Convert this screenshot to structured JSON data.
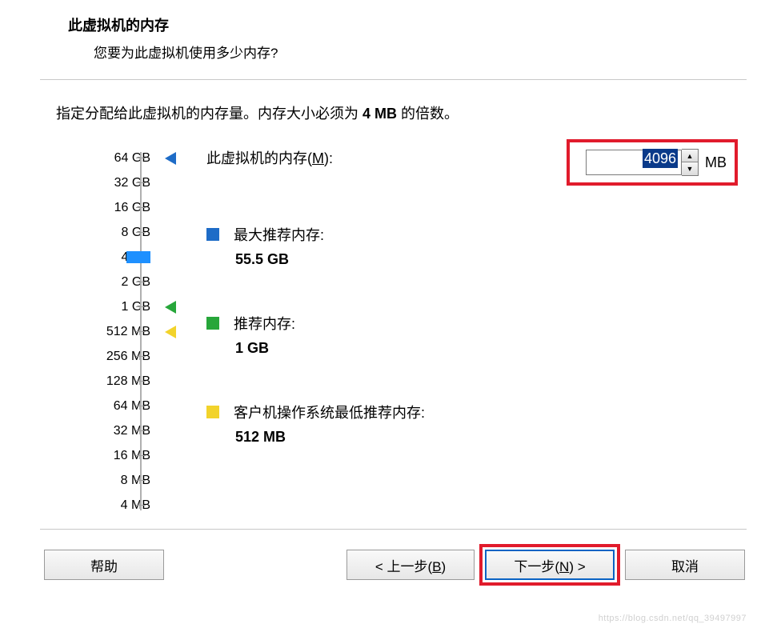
{
  "header": {
    "title": "此虚拟机的内存",
    "subtitle": "您要为此虚拟机使用多少内存?"
  },
  "description": {
    "prefix": "指定分配给此虚拟机的内存量。内存大小必须为 ",
    "bold": "4 MB",
    "suffix": " 的倍数。"
  },
  "memory": {
    "label_prefix": "此虚拟机的内存(",
    "label_hotkey": "M",
    "label_suffix": "):",
    "value": "4096",
    "unit": "MB"
  },
  "slider": {
    "ticks": [
      "64 GB",
      "32 GB",
      "16 GB",
      "8 GB",
      "4 GB",
      "2 GB",
      "1 GB",
      "512 MB",
      "256 MB",
      "128 MB",
      "64 MB",
      "32 MB",
      "16 MB",
      "8 MB",
      "4 MB"
    ],
    "current_index": 4,
    "marker_blue_index": 0,
    "marker_green_index": 6,
    "marker_yellow_index": 7
  },
  "legend": {
    "max": {
      "label": "最大推荐内存:",
      "value": "55.5 GB"
    },
    "rec": {
      "label": "推荐内存:",
      "value": "1 GB"
    },
    "min": {
      "label": "客户机操作系统最低推荐内存:",
      "value": "512 MB"
    }
  },
  "footer": {
    "help": "帮助",
    "back_prefix": "< 上一步(",
    "back_hotkey": "B",
    "back_suffix": ")",
    "next_prefix": "下一步(",
    "next_hotkey": "N",
    "next_suffix": ") >",
    "cancel": "取消"
  },
  "watermark": "https://blog.csdn.net/qq_39497997"
}
